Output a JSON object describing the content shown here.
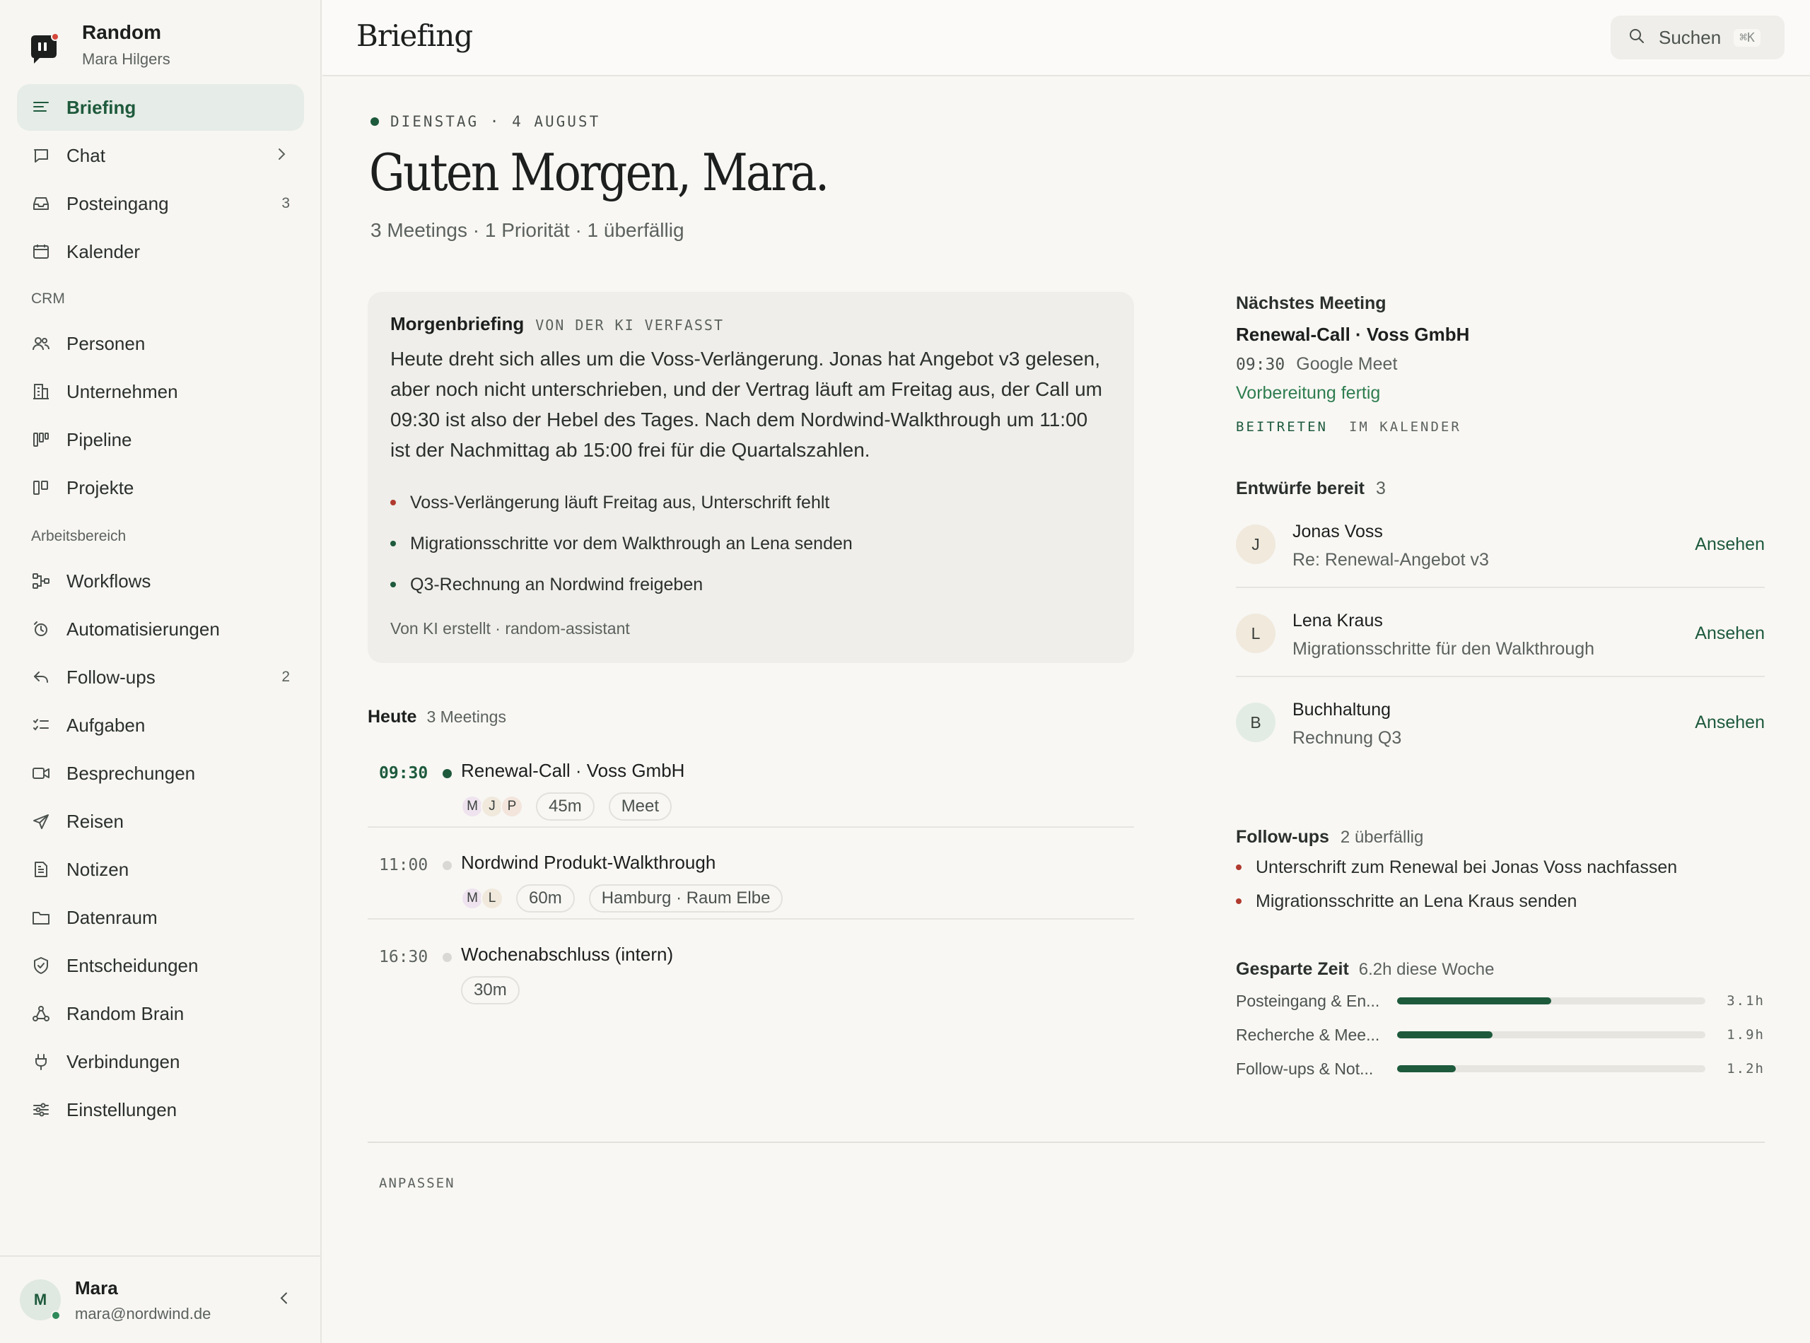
{
  "app": {
    "name": "Random",
    "user_name": "Mara Hilgers",
    "page_title": "Briefing"
  },
  "search": {
    "label": "Suchen",
    "shortcut": "⌘K"
  },
  "sidebar": {
    "items": [
      {
        "label": "Briefing",
        "icon": "briefing-icon",
        "active": true
      },
      {
        "label": "Chat",
        "icon": "chat-icon"
      },
      {
        "label": "Posteingang",
        "icon": "inbox-icon",
        "badge": "3"
      },
      {
        "label": "Kalender",
        "icon": "calendar-icon"
      }
    ],
    "crm_label": "CRM",
    "crm_items": [
      {
        "label": "Personen",
        "icon": "people-icon"
      },
      {
        "label": "Unternehmen",
        "icon": "building-icon"
      },
      {
        "label": "Pipeline",
        "icon": "pipeline-icon"
      },
      {
        "label": "Projekte",
        "icon": "projects-icon"
      }
    ],
    "workspace_label": "Arbeitsbereich",
    "workspace_items": [
      {
        "label": "Workflows",
        "icon": "workflow-icon"
      },
      {
        "label": "Automatisierungen",
        "icon": "automation-icon"
      },
      {
        "label": "Follow-ups",
        "icon": "reply-icon",
        "badge": "2"
      },
      {
        "label": "Aufgaben",
        "icon": "tasks-icon"
      },
      {
        "label": "Besprechungen",
        "icon": "video-icon"
      },
      {
        "label": "Reisen",
        "icon": "plane-icon"
      },
      {
        "label": "Notizen",
        "icon": "notes-icon"
      },
      {
        "label": "Datenraum",
        "icon": "folder-icon"
      },
      {
        "label": "Entscheidungen",
        "icon": "shield-check-icon"
      },
      {
        "label": "Random Brain",
        "icon": "brain-network-icon"
      },
      {
        "label": "Verbindungen",
        "icon": "plug-icon"
      },
      {
        "label": "Einstellungen",
        "icon": "sliders-icon"
      }
    ],
    "footer": {
      "initial": "M",
      "name": "Mara",
      "email": "mara@nordwind.de"
    }
  },
  "main": {
    "dateline": "DIENSTAG · 4 AUGUST",
    "greeting": "Guten Morgen, Mara.",
    "summary": "3 Meetings · 1 Priorität · 1 überfällig",
    "briefing": {
      "title": "Morgenbriefing",
      "tag": "VON DER KI VERFASST",
      "body": "Heute dreht sich alles um die Voss-Verlängerung. Jonas hat Angebot v3 gelesen, aber noch nicht unterschrieben, und der Vertrag läuft am Freitag aus, der Call um 09:30 ist also der Hebel des Tages. Nach dem Nordwind-Walkthrough um 11:00 ist der Nachmittag ab 15:00 frei für die Quartalszahlen.",
      "bullets": [
        {
          "text": "Voss-Verlängerung läuft Freitag aus, Unterschrift fehlt",
          "color": "#b03a2e"
        },
        {
          "text": "Migrationsschritte vor dem Walkthrough an Lena senden",
          "color": "#1e5a3c"
        },
        {
          "text": "Q3-Rechnung an Nordwind freigeben",
          "color": "#1e5a3c"
        }
      ],
      "footer": "Von KI erstellt · random-assistant"
    },
    "today": {
      "title": "Heute",
      "count": "3 Meetings",
      "meetings": [
        {
          "time": "09:30",
          "title": "Renewal-Call · Voss GmbH",
          "attendees": [
            "M",
            "J",
            "P"
          ],
          "duration": "45m",
          "location": "Meet",
          "current": true
        },
        {
          "time": "11:00",
          "title": "Nordwind Produkt-Walkthrough",
          "attendees": [
            "M",
            "L"
          ],
          "duration": "60m",
          "location": "Hamburg · Raum Elbe",
          "current": false
        },
        {
          "time": "16:30",
          "title": "Wochenabschluss (intern)",
          "attendees": [],
          "duration": "30m",
          "location": "",
          "current": false
        }
      ]
    },
    "customize": "ANPASSEN"
  },
  "right": {
    "next_meeting": {
      "heading": "Nächstes Meeting",
      "title": "Renewal-Call · Voss GmbH",
      "time": "09:30",
      "where": "Google Meet",
      "status": "Vorbereitung fertig",
      "join": "BEITRETEN",
      "calendar": "IM KALENDER"
    },
    "drafts": {
      "heading": "Entwürfe bereit",
      "count": "3",
      "items": [
        {
          "initial": "J",
          "name": "Jonas Voss",
          "subject": "Re: Renewal-Angebot v3",
          "action": "Ansehen",
          "bg": "#f0e9dc"
        },
        {
          "initial": "L",
          "name": "Lena Kraus",
          "subject": "Migrationsschritte für den Walkthrough",
          "action": "Ansehen",
          "bg": "#f0e9dc"
        },
        {
          "initial": "B",
          "name": "Buchhaltung",
          "subject": "Rechnung Q3",
          "action": "Ansehen",
          "bg": "#e3ece4"
        }
      ]
    },
    "followups": {
      "heading": "Follow-ups",
      "count": "2 überfällig",
      "items": [
        "Unterschrift zum Renewal bei Jonas Voss nachfassen",
        "Migrationsschritte an Lena Kraus senden"
      ]
    },
    "saved_time": {
      "heading": "Gesparte Zeit",
      "subtitle": "6.2h diese Woche",
      "rows": [
        {
          "label": "Posteingang & En...",
          "value": "3.1h",
          "fraction": 0.5
        },
        {
          "label": "Recherche & Mee...",
          "value": "1.9h",
          "fraction": 0.31
        },
        {
          "label": "Follow-ups & Not...",
          "value": "1.2h",
          "fraction": 0.19
        }
      ]
    }
  },
  "colors": {
    "accent": "#1e5a3c",
    "alert": "#b03a2e",
    "success": "#2e7d4f"
  }
}
